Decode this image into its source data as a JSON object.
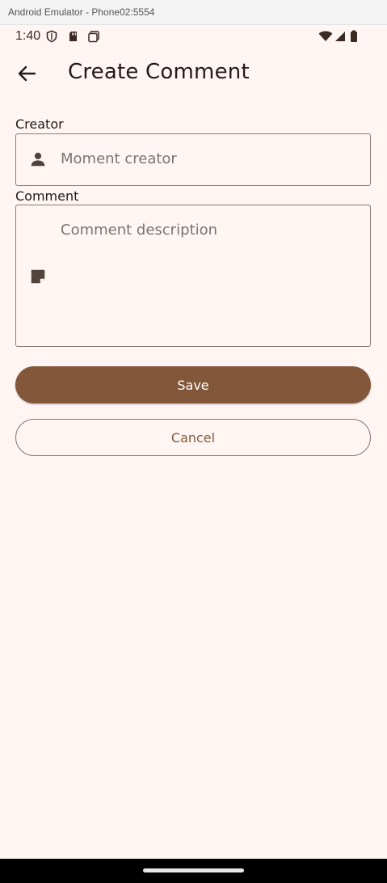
{
  "window": {
    "title": "Android Emulator - Phone02:5554"
  },
  "status_bar": {
    "time": "1:40",
    "left_icons": [
      "shield-icon",
      "sd-card-icon",
      "screenshot-icon"
    ],
    "right_icons": [
      "wifi-icon",
      "signal-icon",
      "battery-icon"
    ]
  },
  "app_bar": {
    "back_icon": "arrow-back-icon",
    "title": "Create Comment"
  },
  "form": {
    "creator": {
      "label": "Creator",
      "icon": "person-icon",
      "placeholder": "Moment creator",
      "value": ""
    },
    "comment": {
      "label": "Comment",
      "icon": "note-icon",
      "placeholder": "Comment description",
      "value": ""
    }
  },
  "actions": {
    "save_label": "Save",
    "cancel_label": "Cancel"
  },
  "colors": {
    "background": "#fff6f4",
    "primary": "#83583a",
    "outline": "#8a7a74",
    "on_surface": "#201a18"
  }
}
